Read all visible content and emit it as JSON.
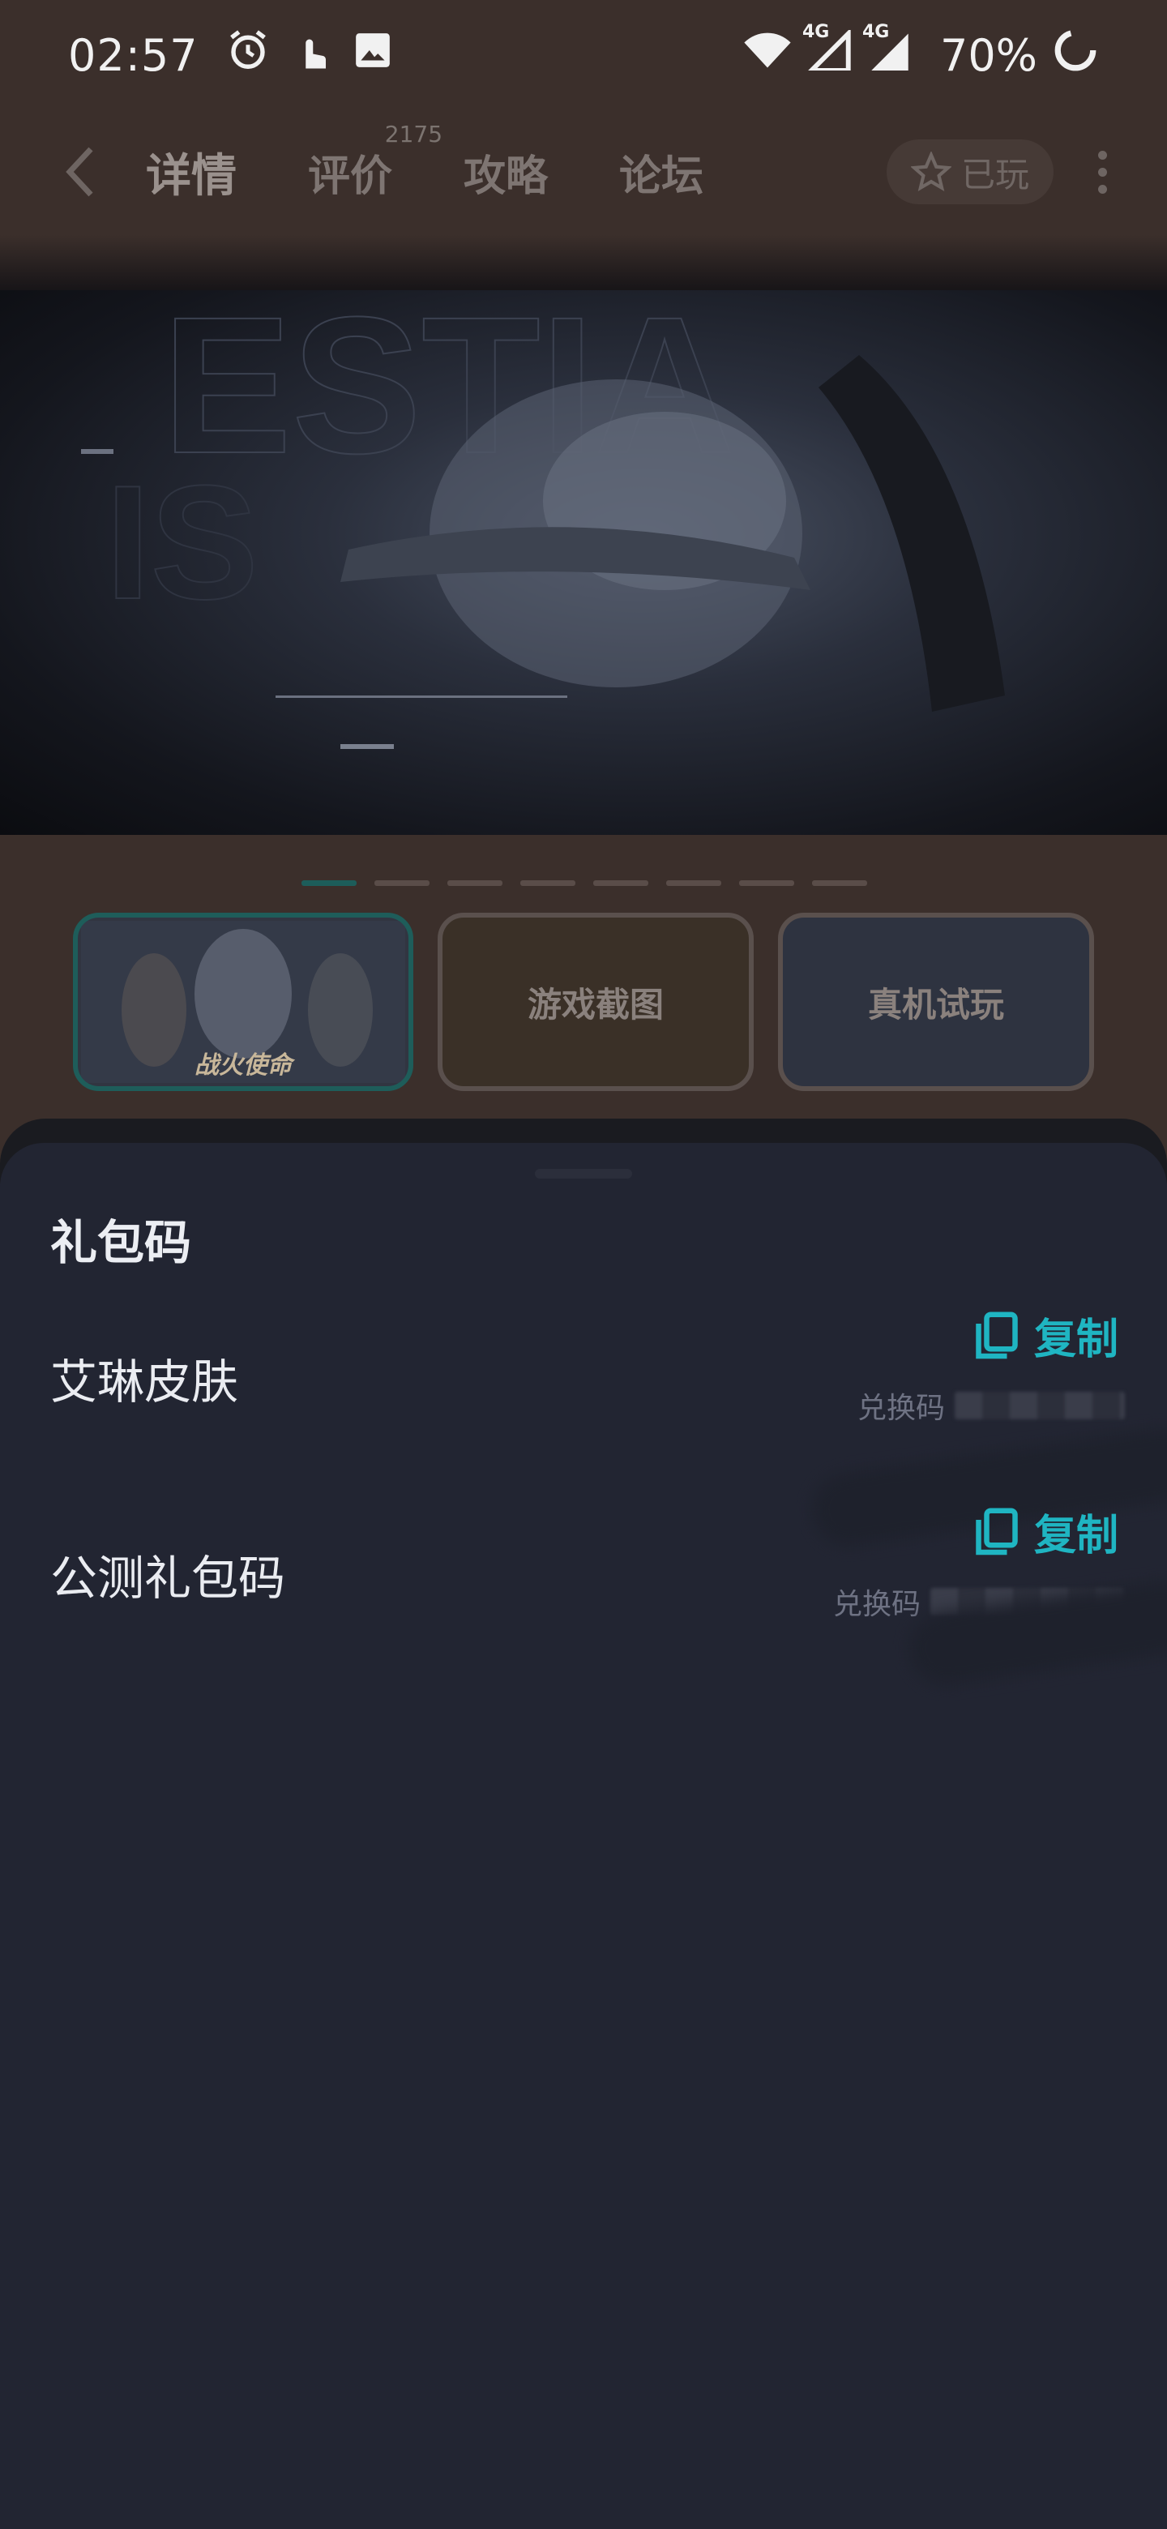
{
  "status_bar": {
    "time": "02:57",
    "battery_percent": "70%",
    "network_1": "4G",
    "network_2": "4G"
  },
  "nav": {
    "tabs": [
      {
        "label": "详情"
      },
      {
        "label": "评价",
        "count": "2175"
      },
      {
        "label": "攻略"
      },
      {
        "label": "论坛"
      }
    ],
    "played_label": "已玩"
  },
  "banner": {
    "dot_count": 8,
    "active_dot": 0
  },
  "thumbnails": {
    "items": [
      {
        "label": "战火使命"
      },
      {
        "label": "游戏截图"
      },
      {
        "label": "真机试玩"
      }
    ]
  },
  "sheet": {
    "title": "礼包码",
    "gifts": [
      {
        "name": "艾琳皮肤",
        "copy_label": "复制",
        "redeem_prefix": "兑换码"
      },
      {
        "name": "公测礼包码",
        "copy_label": "复制",
        "redeem_prefix": "兑换码"
      }
    ]
  },
  "colors": {
    "accent": "#1fb5c2",
    "sheet_bg": "#222532",
    "page_bg": "#3b2f2b"
  }
}
